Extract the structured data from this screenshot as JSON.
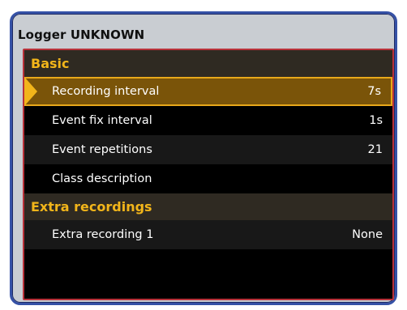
{
  "window": {
    "title": "Logger UNKNOWN"
  },
  "sections": [
    {
      "header": "Basic",
      "rows": [
        {
          "label": "Recording interval",
          "value": "7s",
          "selected": true
        },
        {
          "label": "Event fix interval",
          "value": "1s"
        },
        {
          "label": "Event repetitions",
          "value": "21"
        },
        {
          "label": "Class description",
          "value": ""
        }
      ]
    },
    {
      "header": "Extra recordings",
      "rows": [
        {
          "label": "Extra recording 1",
          "value": "None"
        }
      ]
    }
  ],
  "colors": {
    "accent": "#f2b51a",
    "selected_row": "#7a5409",
    "panel_border": "#b8323a",
    "frame_border": "#3551a6"
  },
  "icons": {
    "selection_pointer": "triangle-right"
  }
}
